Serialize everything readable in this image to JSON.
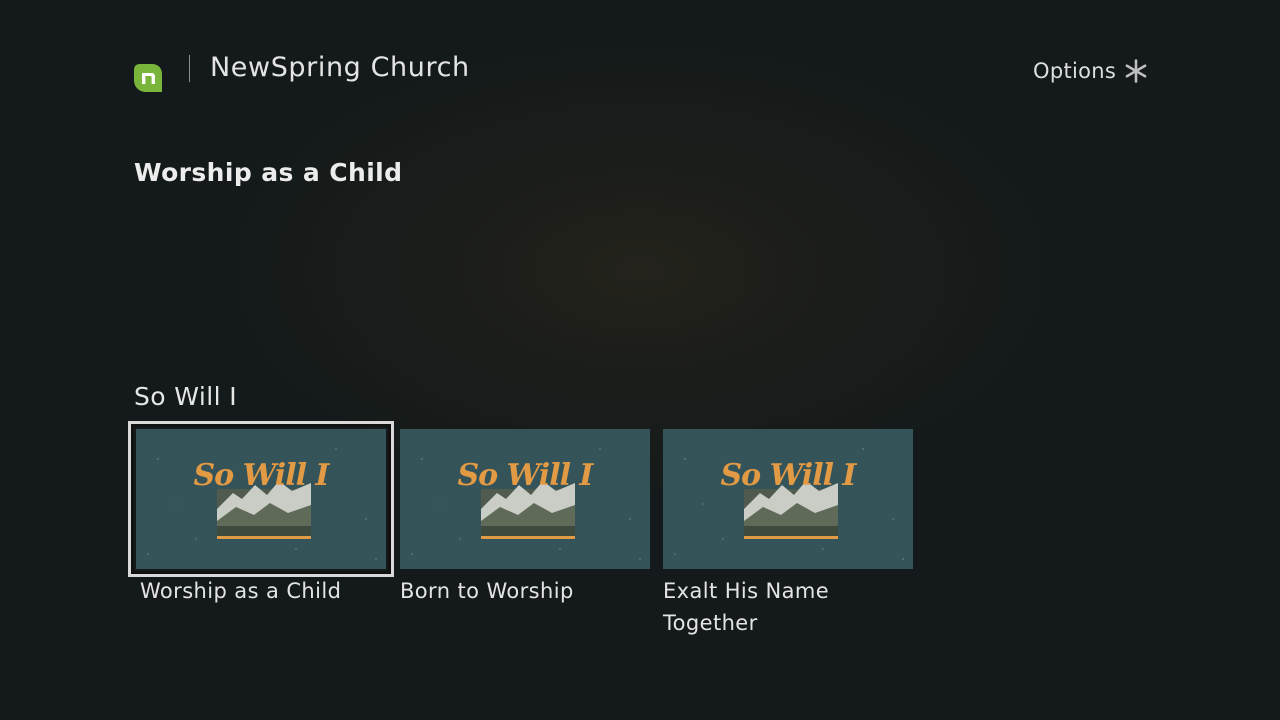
{
  "header": {
    "app_title": "NewSpring Church",
    "options_label": "Options",
    "logo_icon": "newspring-logo-icon",
    "options_icon": "asterisk-icon"
  },
  "page": {
    "title": "Worship as a Child"
  },
  "row": {
    "title": "So Will I",
    "items": [
      {
        "label": "Worship as a Child",
        "focused": true,
        "thumbnail_text": "So Will I"
      },
      {
        "label": "Born to Worship",
        "focused": false,
        "thumbnail_text": "So Will I"
      },
      {
        "label": "Exalt His Name Together",
        "focused": false,
        "thumbnail_text": "So Will I"
      }
    ]
  },
  "colors": {
    "background": "#131a1b",
    "logo_green": "#7ab53b",
    "thumbnail_teal": "#35545a",
    "thumbnail_orange": "#e39a45",
    "focus_outline": "#d9d9d9"
  }
}
